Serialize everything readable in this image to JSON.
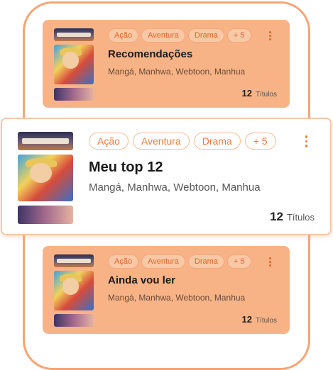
{
  "lists": [
    {
      "name": "Recomendações",
      "tags": [
        "Ação",
        "Aventura",
        "Drama",
        "+ 5"
      ],
      "types": "Mangá, Manhwa, Webtoon, Manhua",
      "count": "12",
      "count_label": "Títulos"
    },
    {
      "name": "Meu top 12",
      "tags": [
        "Ação",
        "Aventura",
        "Drama",
        "+ 5"
      ],
      "types": "Mangá, Manhwa, Webtoon, Manhua",
      "count": "12",
      "count_label": "Títulos"
    },
    {
      "name": "Ainda vou ler",
      "tags": [
        "Ação",
        "Aventura",
        "Drama",
        "+ 5"
      ],
      "types": "Mangá, Manhwa, Webtoon, Manhua",
      "count": "12",
      "count_label": "Títulos"
    }
  ],
  "colors": {
    "accent": "#f07a3c",
    "card_dim": "#f7b386",
    "phone_frame": "#f6a574"
  },
  "icons": {
    "menu": "more-vertical-icon"
  }
}
